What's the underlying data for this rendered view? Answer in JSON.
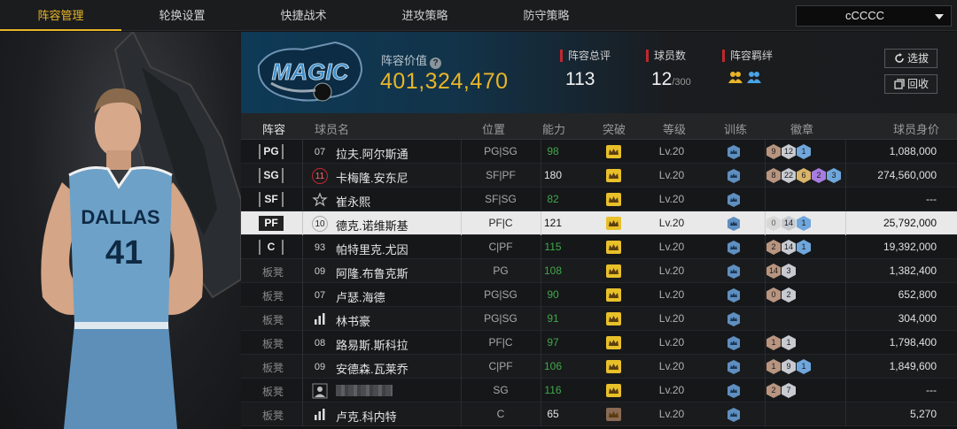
{
  "tabs": [
    {
      "label": "阵容管理",
      "active": true
    },
    {
      "label": "轮换设置",
      "active": false
    },
    {
      "label": "快捷战术",
      "active": false
    },
    {
      "label": "进攻策略",
      "active": false
    },
    {
      "label": "防守策略",
      "active": false
    }
  ],
  "team_select": {
    "value": "cCCCC"
  },
  "header": {
    "value_label": "阵容价值",
    "value": "401,324,470",
    "rating_label": "阵容总评",
    "rating": "113",
    "count_label": "球员数",
    "count": "12",
    "count_max": "/300",
    "bond_label": "阵容羁绊",
    "select_button": "选拔",
    "recycle_button": "回收"
  },
  "columns": {
    "lineup": "阵容",
    "name": "球员名",
    "position": "位置",
    "ability": "能力",
    "breakthrough": "突破",
    "level": "等级",
    "training": "训练",
    "badges": "徽章",
    "value": "球员身价"
  },
  "rows": [
    {
      "slot": "PG",
      "jersey": "07",
      "name": "拉夫.阿尔斯通",
      "position": "PG|SG",
      "ability": "98",
      "level": "Lv.20",
      "badges": [
        [
          "9",
          "bronze"
        ],
        [
          "12",
          "silver"
        ],
        [
          "1",
          "blue"
        ]
      ],
      "value": "1,088,000"
    },
    {
      "slot": "SG",
      "jersey": "11",
      "name": "卡梅隆.安东尼",
      "position": "SF|PF",
      "ability": "180",
      "level": "Lv.20",
      "badges": [
        [
          "8",
          "bronze"
        ],
        [
          "22",
          "silver"
        ],
        [
          "6",
          "gold"
        ],
        [
          "2",
          "purple"
        ],
        [
          "3",
          "blue"
        ]
      ],
      "value": "274,560,000"
    },
    {
      "slot": "SF",
      "jersey": "",
      "name": "崔永熙",
      "position": "SF|SG",
      "ability": "82",
      "level": "Lv.20",
      "badges": [],
      "value": "---"
    },
    {
      "slot": "PF",
      "jersey": "10",
      "name": "德克.诺维斯基",
      "position": "PF|C",
      "ability": "121",
      "level": "Lv.20",
      "badges": [
        [
          "0",
          "empty"
        ],
        [
          "14",
          "silver"
        ],
        [
          "1",
          "blue"
        ]
      ],
      "value": "25,792,000"
    },
    {
      "slot": "C",
      "jersey": "93",
      "name": "帕特里克.尤因",
      "position": "C|PF",
      "ability": "115",
      "level": "Lv.20",
      "badges": [
        [
          "2",
          "bronze"
        ],
        [
          "14",
          "silver"
        ],
        [
          "1",
          "blue"
        ]
      ],
      "value": "19,392,000"
    },
    {
      "slot": "板凳",
      "jersey": "09",
      "name": "阿隆.布鲁克斯",
      "position": "PG",
      "ability": "108",
      "level": "Lv.20",
      "badges": [
        [
          "14",
          "bronze"
        ],
        [
          "3",
          "silver"
        ]
      ],
      "value": "1,382,400"
    },
    {
      "slot": "板凳",
      "jersey": "07",
      "name": "卢瑟.海德",
      "position": "PG|SG",
      "ability": "90",
      "level": "Lv.20",
      "badges": [
        [
          "0",
          "bronze"
        ],
        [
          "2",
          "silver"
        ]
      ],
      "value": "652,800"
    },
    {
      "slot": "板凳",
      "jersey": "",
      "name": "林书豪",
      "position": "PG|SG",
      "ability": "91",
      "level": "Lv.20",
      "badges": [],
      "value": "304,000"
    },
    {
      "slot": "板凳",
      "jersey": "08",
      "name": "路易斯.斯科拉",
      "position": "PF|C",
      "ability": "97",
      "level": "Lv.20",
      "badges": [
        [
          "1",
          "bronze"
        ],
        [
          "1",
          "silver"
        ]
      ],
      "value": "1,798,400"
    },
    {
      "slot": "板凳",
      "jersey": "09",
      "name": "安德森.瓦莱乔",
      "position": "C|PF",
      "ability": "106",
      "level": "Lv.20",
      "badges": [
        [
          "1",
          "bronze"
        ],
        [
          "9",
          "silver"
        ],
        [
          "1",
          "blue"
        ]
      ],
      "value": "1,849,600"
    },
    {
      "slot": "板凳",
      "jersey": "",
      "name": "",
      "position": "SG",
      "ability": "116",
      "level": "Lv.20",
      "badges": [
        [
          "2",
          "bronze"
        ],
        [
          "7",
          "silver"
        ]
      ],
      "value": "---"
    },
    {
      "slot": "板凳",
      "jersey": "",
      "name": "卢克.科内特",
      "position": "C",
      "ability": "65",
      "level": "Lv.20",
      "badges": [],
      "value": "5,270"
    }
  ],
  "colors": {
    "accent": "#e8b52a",
    "green": "#3fa84a",
    "red": "#c0282d",
    "header_blue": "#0e3a57"
  },
  "portrait": {
    "team_text": "DALLAS",
    "number": "41"
  },
  "logo": {
    "text": "MAGIC"
  }
}
